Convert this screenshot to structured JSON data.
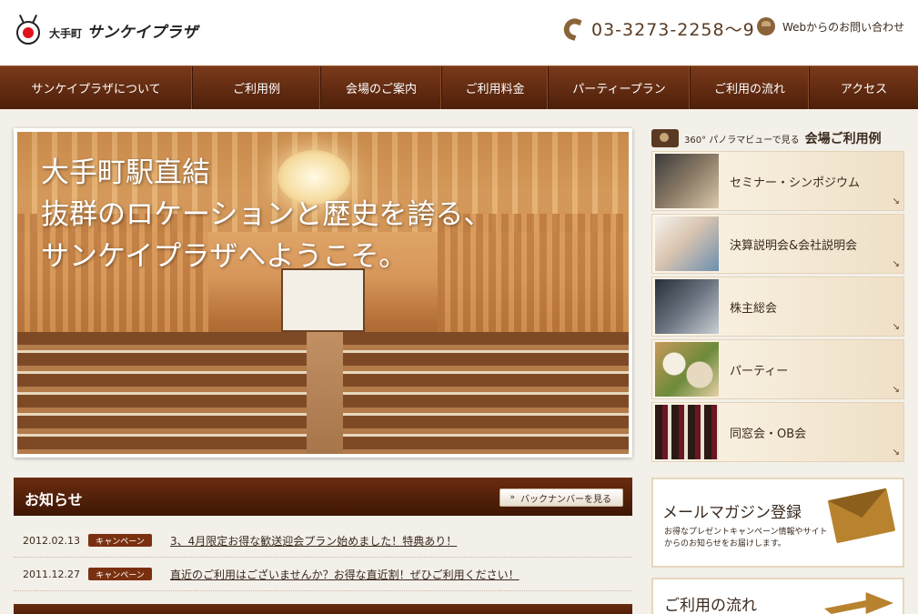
{
  "header": {
    "logo_small": "大手町",
    "logo_large": "サンケイプラザ",
    "phone": "03-3273-2258〜9",
    "contact_label": "Webからのお問い合わせ"
  },
  "nav": {
    "items": [
      {
        "label": "サンケイプラザについて"
      },
      {
        "label": "ご利用例"
      },
      {
        "label": "会場のご案内"
      },
      {
        "label": "ご利用料金"
      },
      {
        "label": "パーティープラン"
      },
      {
        "label": "ご利用の流れ"
      },
      {
        "label": "アクセス"
      }
    ]
  },
  "hero": {
    "lines": [
      "大手町駅直結",
      "抜群のロケーションと歴史を誇る、",
      "サンケイプラザへようこそ。"
    ]
  },
  "sidebar": {
    "title_sub": "360° パノラマビューで見る",
    "title_main": "会場ご利用例",
    "items": [
      {
        "label": "セミナー・シンポジウム"
      },
      {
        "label": "決算説明会&会社説明会"
      },
      {
        "label": "株主総会"
      },
      {
        "label": "パーティー"
      },
      {
        "label": "同窓会・OB会"
      }
    ],
    "arrow": "↘",
    "mail": {
      "title": "メールマガジン登録",
      "desc": "お得なプレゼントキャンペーン情報やサイトからのお知らせをお届けします。"
    },
    "flow": {
      "title": "ご利用の流れ"
    }
  },
  "news": {
    "title": "お知らせ",
    "backnumber_label": "バックナンバーを見る",
    "backnumber_arrow": "»",
    "items": [
      {
        "date": "2012.02.13",
        "badge": "キャンペーン",
        "text": "3、4月限定お得な歓送迎会プラン始めました！特典あり！"
      },
      {
        "date": "2011.12.27",
        "badge": "キャンペーン",
        "text": "直近のご利用はございませんか？お得な直近割！ぜひご利用ください！"
      }
    ]
  },
  "colors": {
    "nav_dark": "#4e1f0a",
    "accent_gold": "#b8822f",
    "badge": "#7a3010"
  }
}
